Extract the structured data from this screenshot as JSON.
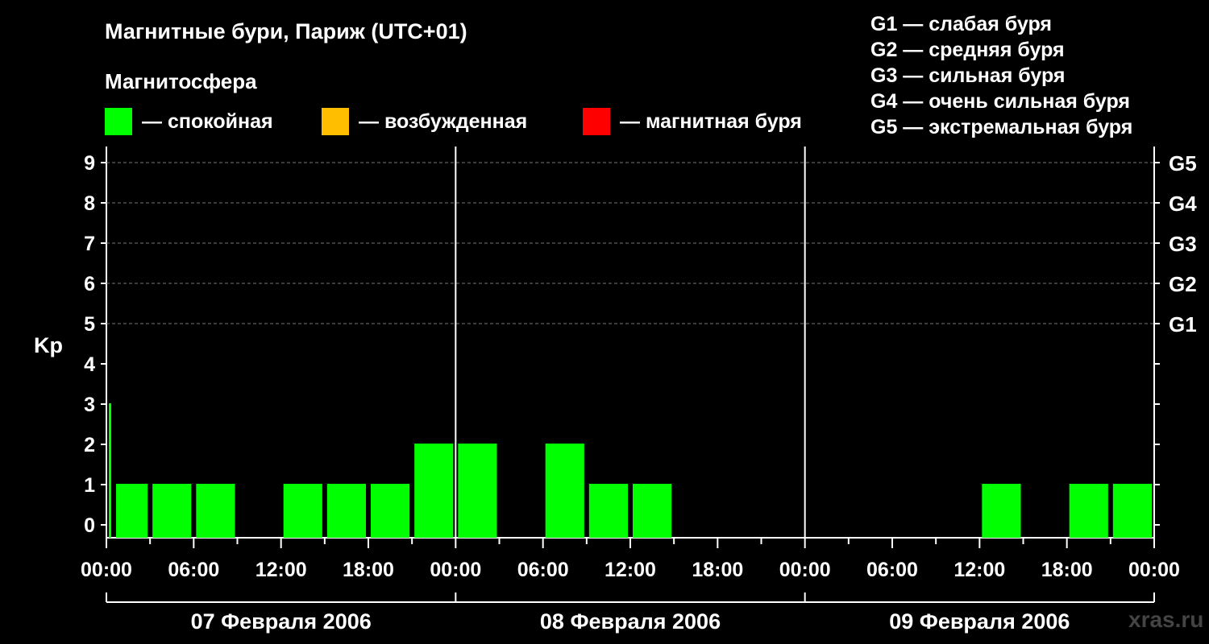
{
  "chart_data": {
    "type": "bar",
    "title": "Магнитные бури, Париж (UTC+01)",
    "subtitle": "Магнитосфера",
    "ylabel": "Kp",
    "ylim": [
      0,
      9
    ],
    "yticks": [
      "0",
      "1",
      "2",
      "3",
      "4",
      "5",
      "6",
      "7",
      "8",
      "9"
    ],
    "storm_ticks": [
      {
        "kp": 5,
        "label": "G1"
      },
      {
        "kp": 7,
        "label": "G3"
      },
      {
        "kp": 6,
        "label": "G2"
      },
      {
        "kp": 8,
        "label": "G4"
      },
      {
        "kp": 9,
        "label": "G5"
      }
    ],
    "legend": [
      {
        "label": "— спокойная",
        "color": "#00ff00"
      },
      {
        "label": "— возбужденная",
        "color": "#ffbf00"
      },
      {
        "label": "— магнитная буря",
        "color": "#ff0000"
      }
    ],
    "storm_scale": [
      "G1 — слабая буря",
      "G2 — средняя буря",
      "G3 — сильная буря",
      "G4 — очень сильная буря",
      "G5 — экстремальная буря"
    ],
    "xtick_labels": [
      "00:00",
      "06:00",
      "12:00",
      "18:00",
      "00:00",
      "06:00",
      "12:00",
      "18:00",
      "00:00",
      "06:00",
      "12:00",
      "18:00",
      "00:00"
    ],
    "days": [
      "07 Февраля 2006",
      "08 Февраля 2006",
      "09 Февраля 2006"
    ],
    "interval_hours": 3,
    "bar_color": "#00ff00",
    "bars": [
      {
        "start_hour": 0,
        "end_hour": 0.5,
        "kp": 3
      },
      {
        "start_hour": 0.5,
        "end_hour": 3,
        "kp": 1
      },
      {
        "start_hour": 3,
        "end_hour": 6,
        "kp": 1
      },
      {
        "start_hour": 6,
        "end_hour": 9,
        "kp": 1
      },
      {
        "start_hour": 9,
        "end_hour": 12,
        "kp": 0
      },
      {
        "start_hour": 12,
        "end_hour": 15,
        "kp": 1
      },
      {
        "start_hour": 15,
        "end_hour": 18,
        "kp": 1
      },
      {
        "start_hour": 18,
        "end_hour": 21,
        "kp": 1
      },
      {
        "start_hour": 21,
        "end_hour": 24,
        "kp": 2
      },
      {
        "start_hour": 24,
        "end_hour": 27,
        "kp": 2
      },
      {
        "start_hour": 27,
        "end_hour": 30,
        "kp": 0
      },
      {
        "start_hour": 30,
        "end_hour": 33,
        "kp": 2
      },
      {
        "start_hour": 33,
        "end_hour": 36,
        "kp": 1
      },
      {
        "start_hour": 36,
        "end_hour": 39,
        "kp": 1
      },
      {
        "start_hour": 60,
        "end_hour": 63,
        "kp": 1
      },
      {
        "start_hour": 66,
        "end_hour": 69,
        "kp": 1
      },
      {
        "start_hour": 69,
        "end_hour": 72,
        "kp": 1
      }
    ],
    "grid": true
  },
  "watermark": "xras.ru"
}
